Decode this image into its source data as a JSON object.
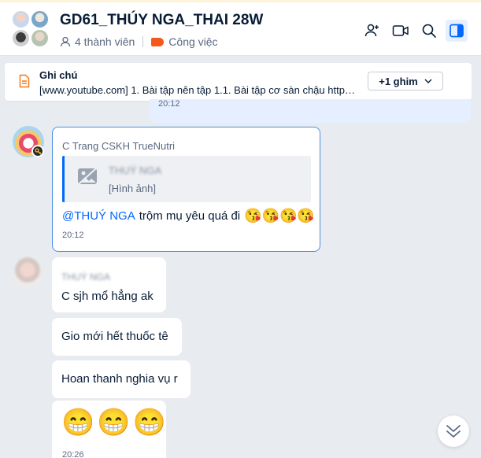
{
  "header": {
    "title": "GD61_THÚY NGA_THAI 28W",
    "members": "4 thành viên",
    "label": "Công việc",
    "label_color": "#f25a1d"
  },
  "pinned": {
    "title": "Ghi chú",
    "text": "[www.youtube.com] 1. Bài tập nên tập 1.1. Bài tập cơ sàn chậu https:...",
    "more_button": "+1 ghim"
  },
  "messages": {
    "prev_time": "20:12",
    "reply": {
      "sender": "C Trang CSKH TrueNutri",
      "quoted_name": "THUÝ NGA",
      "quoted_type": "[Hình ảnh]",
      "mention": "@THUÝ NGA",
      "text": "trộm mụ yêu quá đi",
      "emojis": "😘😘😘😘",
      "time": "20:12"
    },
    "group": {
      "sender": "THUÝ NGA",
      "m1": "C sjh mổ hẳng ak",
      "m2": "Gio mới hết thuốc tê",
      "m3": "Hoan thanh nghia vụ r",
      "m4": "😁😁😁",
      "time": "20:26"
    }
  },
  "icons": {
    "add_member": "add-member-icon",
    "video": "video-call-icon",
    "search": "search-icon",
    "sidebar": "sidebar-toggle-icon",
    "scroll": "chevron-double-down-icon"
  },
  "colors": {
    "accent": "#0068ff",
    "reply_border": "#4a90e2",
    "chat_bg": "#e8ecf1"
  }
}
